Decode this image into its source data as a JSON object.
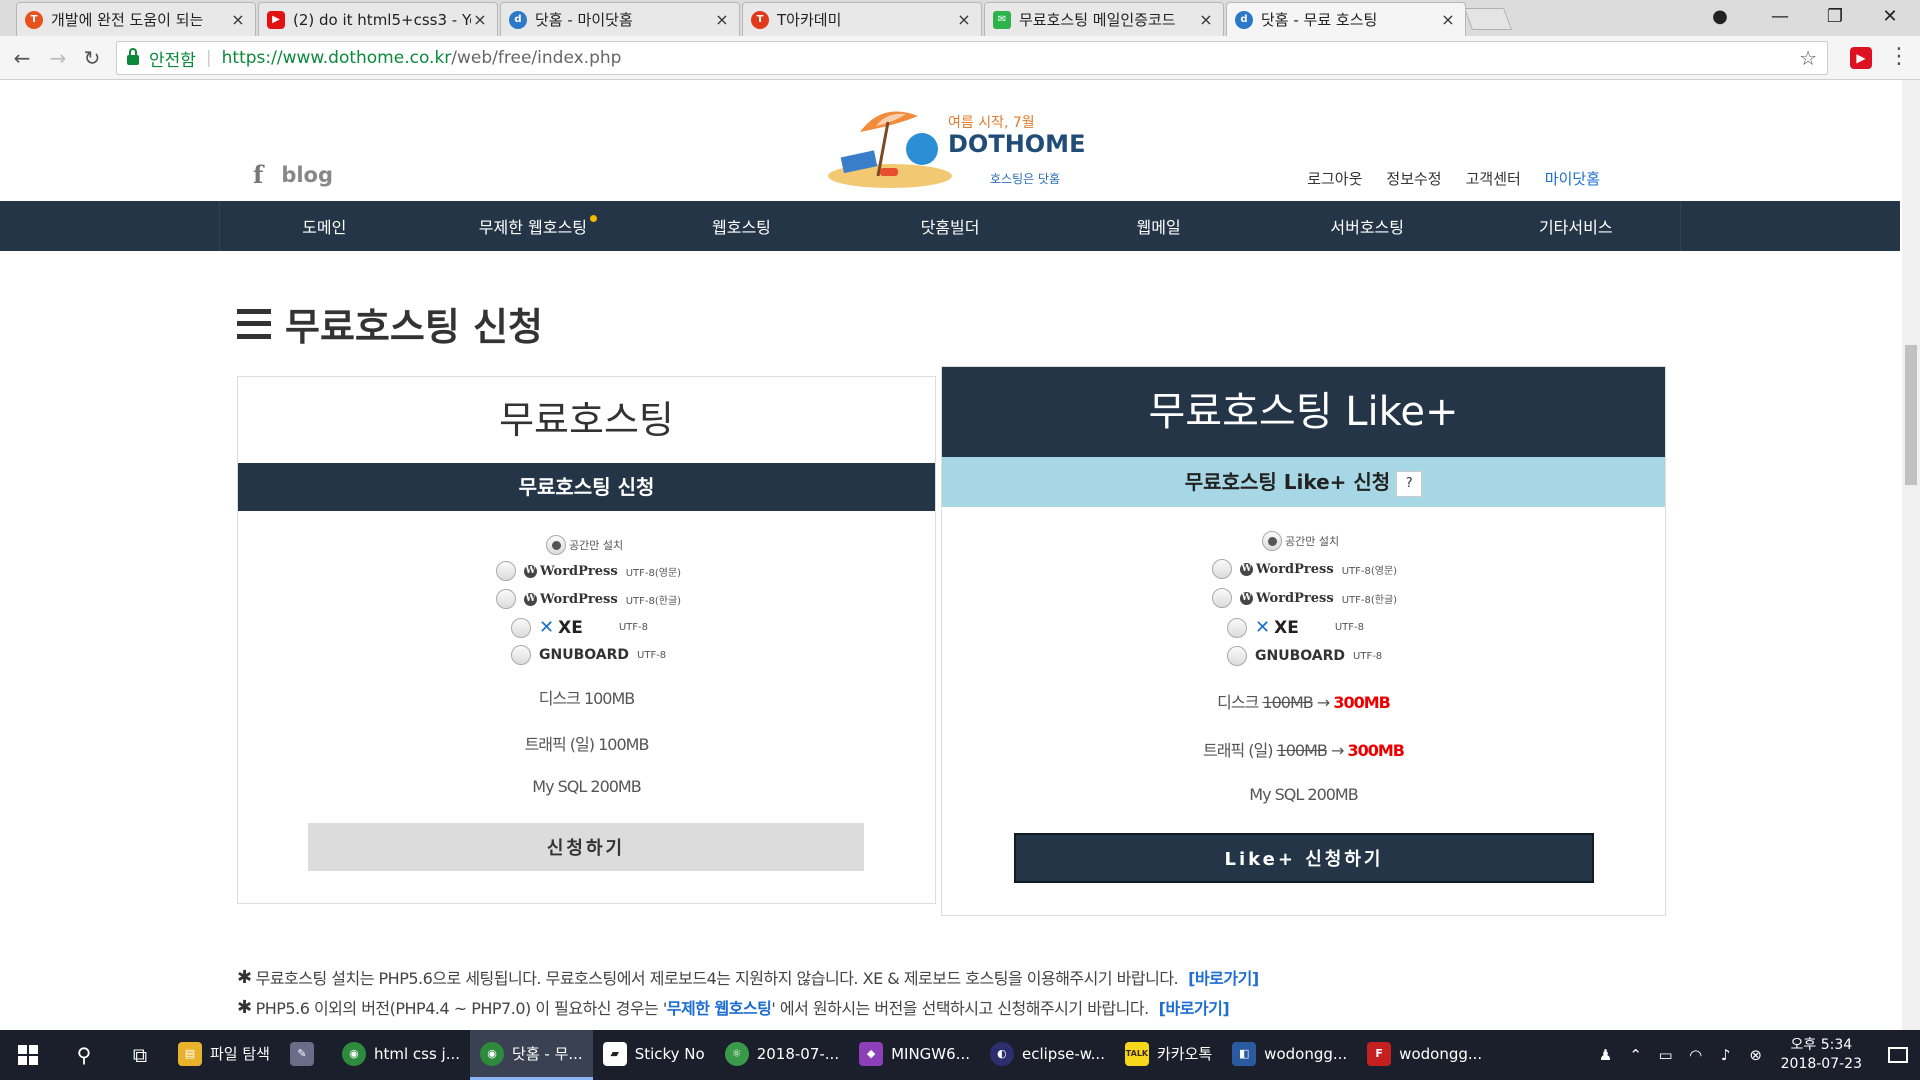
{
  "browser": {
    "tabs": [
      {
        "title": "개발에 완전 도움이 되는",
        "fav_color": "#e8521e",
        "fav_char": "T"
      },
      {
        "title": "(2) do it html5+css3 - Yo",
        "fav_color": "#e21212",
        "fav_char": "▶"
      },
      {
        "title": "닷홈 - 마이닷홈",
        "fav_color": "#2c78c9",
        "fav_char": "d"
      },
      {
        "title": "T아카데미",
        "fav_color": "#e03a1a",
        "fav_char": "T"
      },
      {
        "title": "무료호스팅 메일인증코드",
        "fav_color": "#2db34a",
        "fav_char": "✉"
      },
      {
        "title": "닷홈 - 무료 호스팅",
        "fav_color": "#2c78c9",
        "fav_char": "d"
      }
    ],
    "close_glyph": "×",
    "window_controls": {
      "profile": "●",
      "minimize": "—",
      "maximize": "❐",
      "close": "✕"
    },
    "nav": {
      "back": "←",
      "forward": "→",
      "reload": "↻"
    },
    "address": {
      "secure_label": "안전함",
      "separator": "|",
      "url_host": "https://www.dothome.co.kr",
      "url_path": "/web/free/index.php"
    },
    "star_glyph": "☆",
    "extension_label": "▶",
    "menu_glyph": "⋮"
  },
  "site": {
    "fb_glyph": "f",
    "blog_label": "blog",
    "logo": {
      "name": "DOTHOME",
      "slogan": "여름 시작, 7월",
      "sub": "호스팅은 닷홈"
    },
    "top_links": [
      "로그아웃",
      "정보수정",
      "고객센터",
      "마이닷홈"
    ],
    "nav": [
      "도메인",
      "무제한 웹호스팅",
      "웹호스팅",
      "닷홈빌더",
      "웹메일",
      "서버호스팅",
      "기타서비스"
    ],
    "accent_color": "#243547",
    "plus_bar_color": "#a7d7e4"
  },
  "main": {
    "title": "무료호스팅 신청",
    "free": {
      "heading": "무료호스팅",
      "subheading": "무료호스팅 신청",
      "options": {
        "space_only": "공간만 설치",
        "wp_name": "WordPress",
        "wp_icon": "W",
        "wp_en": "UTF-8(영문)",
        "wp_ko": "UTF-8(한글)",
        "xe_name": "XE",
        "xe_enc": "UTF-8",
        "gnu_name": "GNUBOARD",
        "gnu_enc": "UTF-8"
      },
      "disk": "디스크 100MB",
      "traffic": "트래픽 (일) 100MB",
      "mysql": "My SQL 200MB",
      "button": "신청하기"
    },
    "plus": {
      "heading": "무료호스팅 Like+",
      "subheading": "무료호스팅 Like+ 신청",
      "help": "?",
      "disk_label": "디스크",
      "disk_old": "100MB",
      "disk_new": "300MB",
      "traffic_label": "트래픽 (일)",
      "traffic_old": "100MB",
      "traffic_new": "300MB",
      "arrow": "→",
      "mysql": "My SQL 200MB",
      "button": "Like+ 신청하기"
    },
    "notes": [
      {
        "text": "무료호스팅 설치는 PHP5.6으로 세팅됩니다. 무료호스팅에서 제로보드4는 지원하지 않습니다. XE & 제로보드 호스팅을 이용해주시기 바랍니다.",
        "link": "[바로가기]"
      },
      {
        "pre": "PHP5.6 이외의 버전(PHP4.4 ~ PHP7.0) 이 필요하신 경우는 '",
        "highlight": "무제한 웹호스팅",
        "post": "' 에서 원하시는 버전을 선택하시고 신청해주시기 바랍니다.",
        "link": "[바로가기]"
      }
    ],
    "note_mark": "✱"
  },
  "taskbar": {
    "apps": [
      {
        "label": "파일 탐색",
        "icon_color": "#e9b22c",
        "icon_char": "▤"
      },
      {
        "label": "",
        "icon_color": "#6b6b8a",
        "icon_char": "✎"
      },
      {
        "label": "html css j...",
        "icon_color": "#2e8b3e",
        "icon_char": "◉"
      },
      {
        "label": "닷홈 - 무...",
        "icon_color": "#2e8b3e",
        "icon_char": "◉",
        "active": true
      },
      {
        "label": "Sticky No",
        "icon_color": "#ffffff",
        "icon_char": "▰"
      },
      {
        "label": "2018-07-...",
        "icon_color": "#3a9a4a",
        "icon_char": "⚛"
      },
      {
        "label": "MINGW6...",
        "icon_color": "#8c3fb8",
        "icon_char": "◆"
      },
      {
        "label": "eclipse-w...",
        "icon_color": "#2c2e6e",
        "icon_char": "◐"
      },
      {
        "label": "카카오톡",
        "icon_color": "#f7d71c",
        "icon_char": "TALK"
      },
      {
        "label": "wodongg...",
        "icon_color": "#2a5aa0",
        "icon_char": "◧"
      },
      {
        "label": "wodongg...",
        "icon_color": "#c3201f",
        "icon_char": "F"
      }
    ],
    "search_glyph": "⚲",
    "taskview_glyph": "⧉",
    "tray_icons": [
      "♟",
      "⌃",
      "▭",
      "◠",
      "♪",
      "⊗"
    ],
    "time": "오후 5:34",
    "date": "2018-07-23"
  }
}
